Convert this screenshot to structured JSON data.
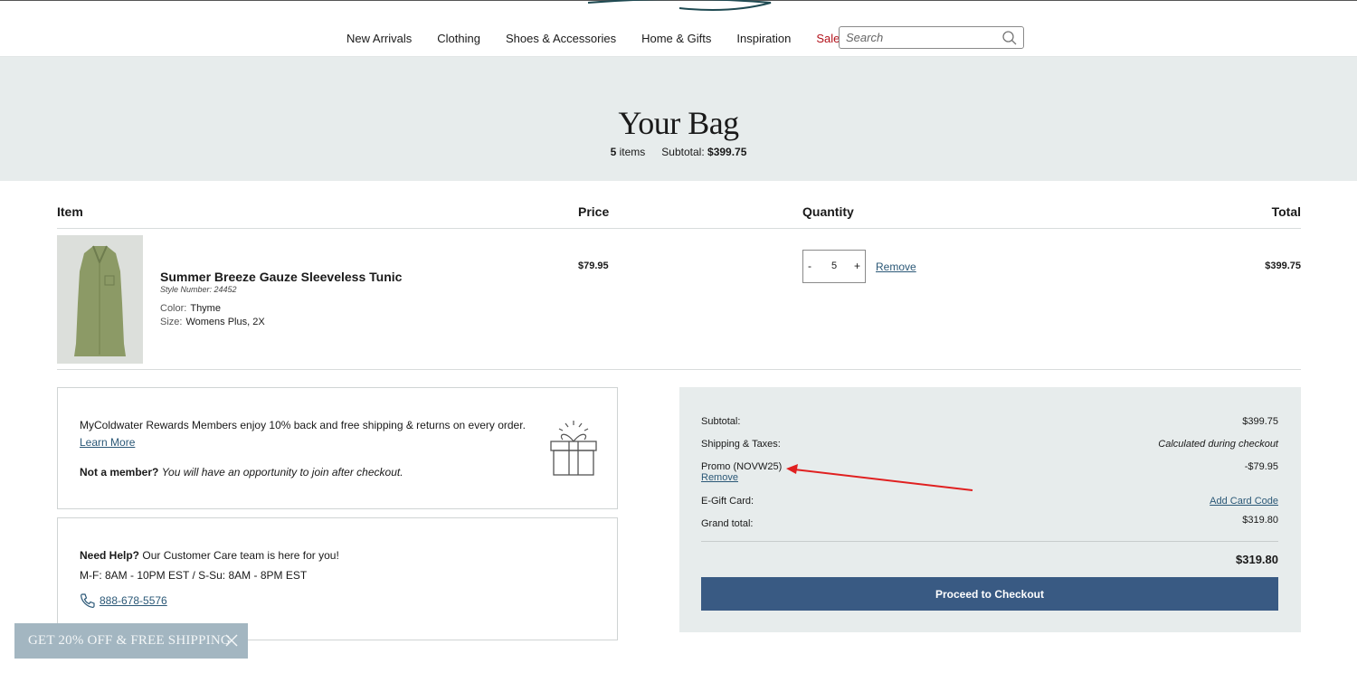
{
  "nav": {
    "items": [
      "New Arrivals",
      "Clothing",
      "Shoes & Accessories",
      "Home & Gifts",
      "Inspiration",
      "Sale"
    ],
    "search_placeholder": "Search"
  },
  "hero": {
    "title": "Your Bag",
    "item_count": "5",
    "items_label": "items",
    "subtotal_label": "Subtotal:",
    "subtotal_value": "$399.75"
  },
  "table": {
    "headers": {
      "item": "Item",
      "price": "Price",
      "quantity": "Quantity",
      "total": "Total"
    }
  },
  "line_item": {
    "name": "Summer Breeze Gauze Sleeveless Tunic",
    "style_number": "Style Number: 24452",
    "color_label": "Color:",
    "color_value": "Thyme",
    "size_label": "Size:",
    "size_value": "Womens Plus, 2X",
    "price": "$79.95",
    "quantity": "5",
    "minus": "-",
    "plus": "+",
    "remove": "Remove",
    "total": "$399.75"
  },
  "rewards": {
    "text": "MyColdwater Rewards Members enjoy 10% back and free shipping & returns on every order.",
    "learn_more": "Learn More",
    "not_member_bold": "Not a member?",
    "not_member_text": "You will have an opportunity to join after checkout."
  },
  "help": {
    "bold": "Need Help?",
    "text": "Our Customer Care team is here for you!",
    "hours": "M-F: 8AM - 10PM EST / S-Su: 8AM - 8PM EST",
    "phone": "888-678-5576"
  },
  "summary": {
    "subtotal_label": "Subtotal:",
    "subtotal_value": "$399.75",
    "shipping_label": "Shipping & Taxes:",
    "shipping_value": "Calculated during checkout",
    "promo_label": "Promo (NOVW25)",
    "promo_value": "-$79.95",
    "promo_remove": "Remove",
    "egift_label": "E-Gift Card:",
    "egift_link": "Add Card Code",
    "grand_label": "Grand total:",
    "grand_value": "$319.80",
    "total": "$319.80",
    "checkout": "Proceed to Checkout"
  },
  "banner": {
    "text": "GET 20% OFF & FREE SHIPPING"
  },
  "colors": {
    "accent_blue": "#395a83",
    "sale_red": "#b3121b",
    "hero_bg": "#e7ecec",
    "annotation_red": "#e02020"
  }
}
